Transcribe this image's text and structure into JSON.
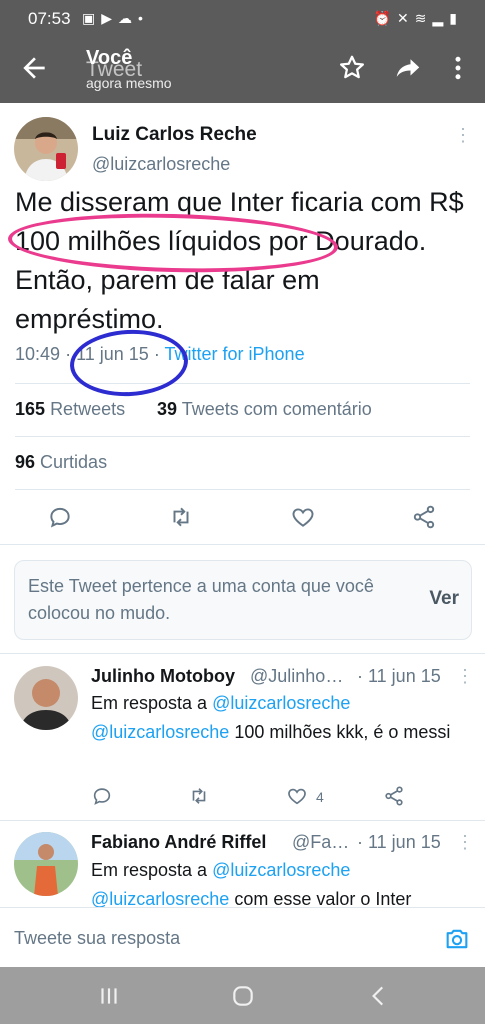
{
  "status_bar": {
    "time": "07:53",
    "left_icons": [
      "image-icon",
      "youtube-icon",
      "cloud-icon",
      "dot-icon"
    ],
    "right_icons": [
      "alarm-icon",
      "mute-icon",
      "wifi-icon",
      "signal-icon",
      "battery-icon"
    ]
  },
  "app_bar": {
    "title": "Você",
    "title_under": "Tweet",
    "subtitle": "agora mesmo",
    "icons": [
      "back-arrow-icon",
      "star-icon",
      "share-icon",
      "more-vertical-icon"
    ]
  },
  "tweet": {
    "author_name": "Luiz Carlos Reche",
    "author_handle": "@luizcarlosreche",
    "text": "Me disseram que Inter ficaria  com R$ 100 milhões líquidos por Dourado. Então, parem de falar em empréstimo.",
    "time": "10:49",
    "date": "11 jun 15",
    "separator": "·",
    "source": "Twitter for iPhone",
    "retweets_count": "165",
    "retweets_label": "Retweets",
    "quotes_count": "39",
    "quotes_label": "Tweets com comentário",
    "likes_count": "96",
    "likes_label": "Curtidas",
    "action_icons": [
      "reply-icon",
      "retweet-icon",
      "like-icon",
      "share-icon"
    ]
  },
  "muted_notice": {
    "text": "Este Tweet pertence a uma conta que você colocou no mudo.",
    "button": "Ver"
  },
  "replies": [
    {
      "name": "Julinho Motoboy",
      "handle": "@Julinho…",
      "date": "· 11 jun 15",
      "reply_prefix": "Em resposta a",
      "reply_to": "@luizcarlosreche",
      "mention": "@luizcarlosreche",
      "text": " 100 milhões kkk, é o messi",
      "like_count": "4"
    },
    {
      "name": "Fabiano André Riffel",
      "handle": "@Fa…",
      "date": "· 11 jun 15",
      "reply_prefix": "Em resposta a",
      "reply_to": "@luizcarlosreche",
      "mention": "@luizcarlosreche",
      "text": " com esse valor o Inter"
    }
  ],
  "compose": {
    "placeholder": "Tweete sua resposta"
  },
  "colors": {
    "accent": "#1da1f2",
    "app_bar": "#5b5b5b",
    "annotation_pink": "#ea3b8e",
    "annotation_blue": "#2c2cd0"
  }
}
